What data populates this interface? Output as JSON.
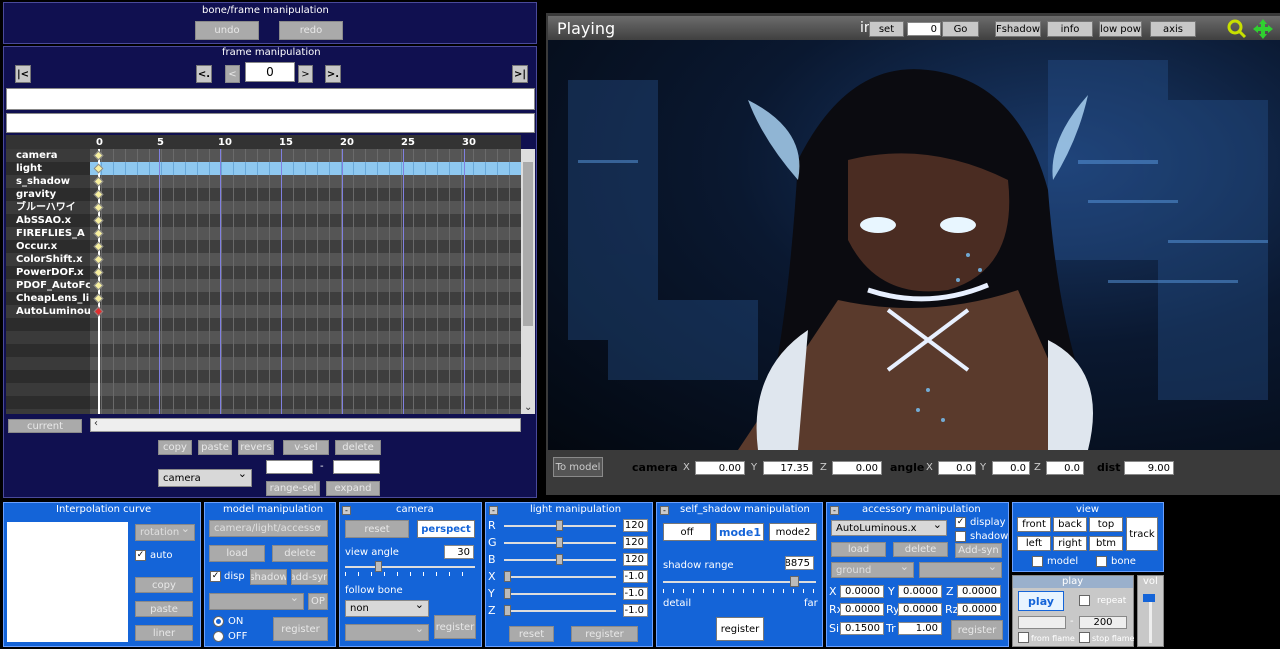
{
  "colors": {
    "panel": "#1464d8",
    "navy": "#101050",
    "accent_selected": "#8ec8f0",
    "key_red": "#e03030",
    "key_yellow": "#f8f0a0"
  },
  "left": {
    "bone_frame_title": "bone/frame manipulation",
    "undo": "undo",
    "redo": "redo",
    "frame_title": "frame manipulation",
    "frame_value": "0",
    "first_icon": "|<",
    "prev_key": "<.",
    "prev": "<",
    "next": ">",
    "next_key": ">.",
    "last_icon": ">|",
    "ticks": [
      "0",
      "5",
      "10",
      "15",
      "20",
      "25",
      "30"
    ],
    "rows": [
      "camera",
      "light",
      "s_shadow",
      "gravity",
      "ブルーハワイ",
      "AbSSAO.x",
      "FIREFLIES_A",
      "Occur.x",
      "ColorShift.x",
      "PowerDOF.x",
      "PDOF_AutoFc",
      "CheapLens_li",
      "AutoLuminous"
    ],
    "current": "current",
    "copy": "copy",
    "paste": "paste",
    "revers": "revers",
    "vsel": "v-sel",
    "delete": "delete",
    "target_select": "camera",
    "range_sep": "-",
    "range_sel": "range-sel",
    "expand": "expand"
  },
  "viewer": {
    "status": "Playing",
    "info_prefix": "in",
    "set": "set",
    "frame_input": "0",
    "go": "Go",
    "fshadow": "Fshadow",
    "info": "info",
    "low_pow": "low pow",
    "axis": "axis",
    "to_model": "To model",
    "camera_label": "camera",
    "cam_x_label": "X",
    "cam_x": "0.00",
    "cam_y_label": "Y",
    "cam_y": "17.35",
    "cam_z_label": "Z",
    "cam_z": "0.00",
    "angle_label": "angle",
    "ang_x_label": "X",
    "ang_x": "0.0",
    "ang_y_label": "Y",
    "ang_y": "0.0",
    "ang_z_label": "Z",
    "ang_z": "0.0",
    "dist_label": "dist",
    "dist": "9.00"
  },
  "interp": {
    "title": "Interpolation curve",
    "type": "rotation",
    "auto": "auto",
    "copy": "copy",
    "paste": "paste",
    "liner": "liner"
  },
  "model": {
    "title": "model manipulation",
    "select": "camera/light/accesso",
    "load": "load",
    "delete": "delete",
    "disp": "disp",
    "shadow": "shadow",
    "addsyn": "add-syn",
    "op": "OP",
    "on": "ON",
    "off": "OFF",
    "register": "register"
  },
  "camera": {
    "title": "camera",
    "reset": "reset",
    "perspect": "perspect",
    "view_angle": "view angle",
    "view_angle_value": "30",
    "follow_bone": "follow bone",
    "follow": "non",
    "register": "register"
  },
  "light": {
    "title": "light manipulation",
    "rows": [
      {
        "l": "R",
        "v": "120"
      },
      {
        "l": "G",
        "v": "120"
      },
      {
        "l": "B",
        "v": "120"
      },
      {
        "l": "X",
        "v": "-1.0"
      },
      {
        "l": "Y",
        "v": "-1.0"
      },
      {
        "l": "Z",
        "v": "-1.0"
      }
    ],
    "reset": "reset",
    "register": "register"
  },
  "self_shadow": {
    "title": "self_shadow manipulation",
    "off": "off",
    "mode1": "mode1",
    "mode2": "mode2",
    "range_label": "shadow range",
    "range_value": "8875",
    "detail": "detail",
    "far": "far",
    "register": "register"
  },
  "accessory": {
    "title": "accessory manipulation",
    "select": "AutoLuminous.x",
    "display": "display",
    "shadow": "shadow",
    "load": "load",
    "delete": "delete",
    "addsyn": "Add-syn",
    "parent": "ground",
    "X": "0.0000",
    "Y": "0.0000",
    "Z": "0.0000",
    "Rx": "0.0000",
    "Ry": "0.0000",
    "Rz": "0.0000",
    "Si": "0.1500",
    "Tr": "1.00",
    "register": "register"
  },
  "view": {
    "title": "view",
    "front": "front",
    "back": "back",
    "top": "top",
    "left": "left",
    "right": "right",
    "btm": "btm",
    "track": "track",
    "model": "model",
    "bone": "bone"
  },
  "play": {
    "title": "play",
    "play": "play",
    "repeat": "repeat",
    "from_value": "",
    "to_value": "200",
    "sep": "-",
    "from_flame": "from flame",
    "stop_flame": "stop flame",
    "vol": "vol"
  }
}
